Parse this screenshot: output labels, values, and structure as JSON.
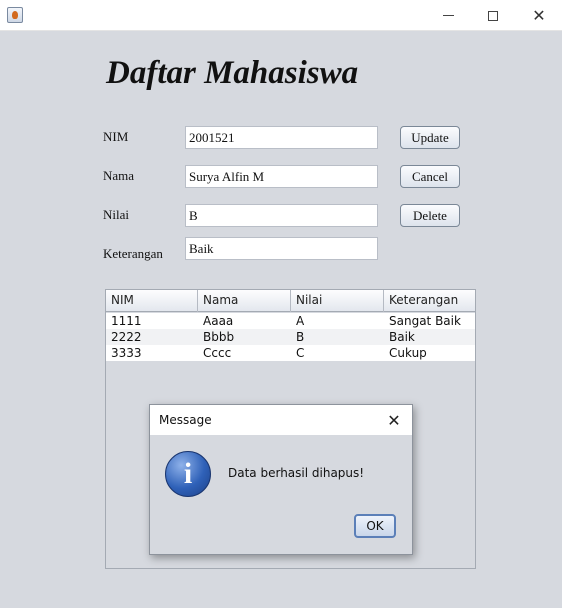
{
  "window": {
    "minimize": "—",
    "close": "✕"
  },
  "page_title": "Daftar Mahasiswa",
  "form": {
    "nim_label": "NIM",
    "nim_value": "2001521",
    "nama_label": "Nama",
    "nama_value": "Surya Alfin M",
    "nilai_label": "Nilai",
    "nilai_value": "B",
    "keterangan_label": "Keterangan",
    "keterangan_value": "Baik"
  },
  "buttons": {
    "update": "Update",
    "cancel": "Cancel",
    "delete": "Delete"
  },
  "table": {
    "headers": [
      "NIM",
      "Nama",
      "Nilai",
      "Keterangan"
    ],
    "rows": [
      [
        "1111",
        "Aaaa",
        "A",
        "Sangat Baik"
      ],
      [
        "2222",
        "Bbbb",
        "B",
        "Baik"
      ],
      [
        "3333",
        "Cccc",
        "C",
        "Cukup"
      ]
    ]
  },
  "dialog": {
    "title": "Message",
    "close": "✕",
    "icon": "info-icon",
    "icon_glyph": "i",
    "message": "Data berhasil dihapus!",
    "ok": "OK"
  }
}
